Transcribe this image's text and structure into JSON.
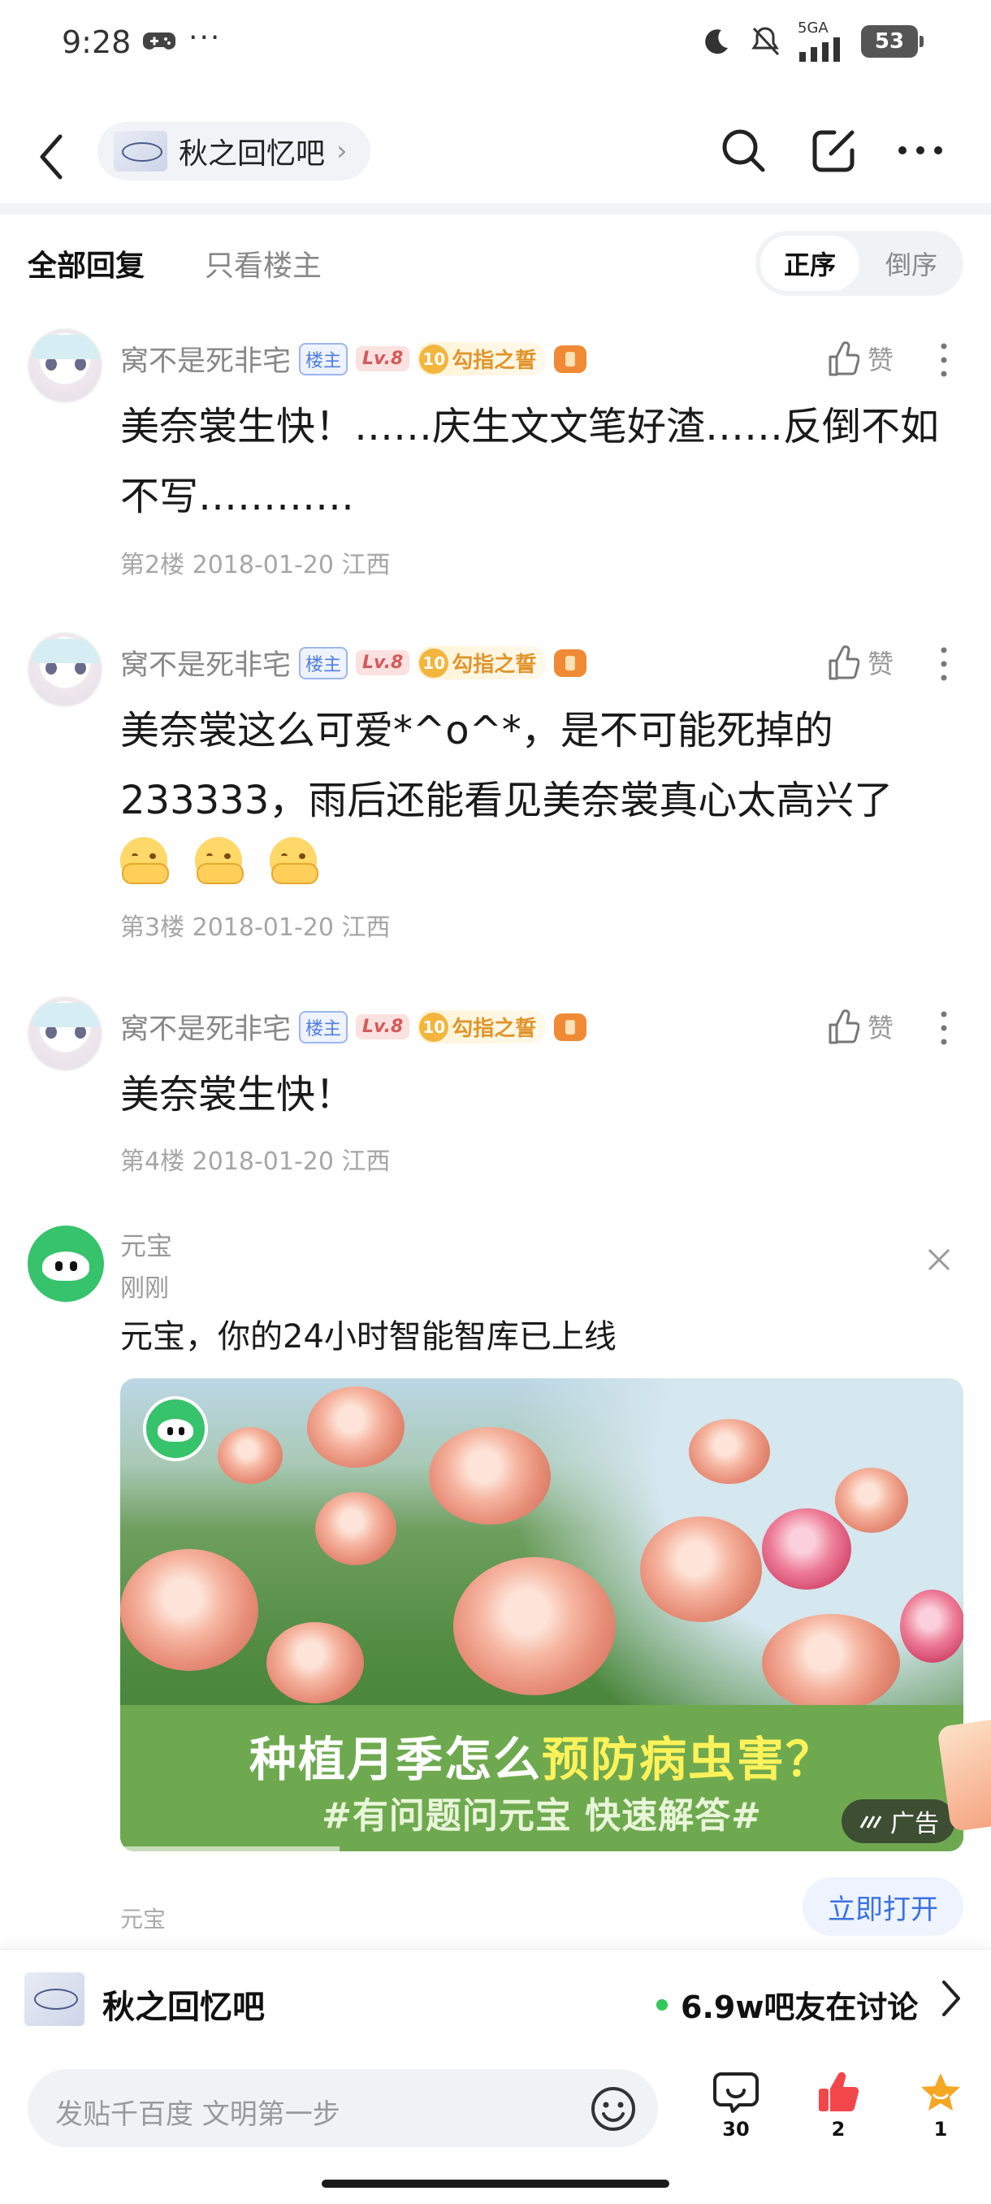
{
  "status_bar": {
    "time": "9:28",
    "dots": "···",
    "network": "5GA",
    "battery": "53"
  },
  "nav": {
    "forum_name": "秋之回忆吧"
  },
  "sort_tabs": {
    "all_replies": "全部回复",
    "owner_only": "只看楼主",
    "asc": "正序",
    "desc": "倒序"
  },
  "posts": [
    {
      "username": "窝不是死非宅",
      "owner_badge": "楼主",
      "level": "Lv.8",
      "medal_num": "10",
      "medal_text": "勾指之誓",
      "like_label": "赞",
      "content": "美奈裳生快！……庆生文文笔好渣……反倒不如不写…………",
      "meta": "第2楼 2018-01-20 江西"
    },
    {
      "username": "窝不是死非宅",
      "owner_badge": "楼主",
      "level": "Lv.8",
      "medal_num": "10",
      "medal_text": "勾指之誓",
      "like_label": "赞",
      "content": "美奈裳这么可爱*^o^*，是不可能死掉的233333，雨后还能看见美奈裳真心太高兴了",
      "emojis": [
        "hug-emoji",
        "hug-emoji",
        "hug-emoji"
      ],
      "meta": "第3楼 2018-01-20 江西"
    },
    {
      "username": "窝不是死非宅",
      "owner_badge": "楼主",
      "level": "Lv.8",
      "medal_num": "10",
      "medal_text": "勾指之誓",
      "like_label": "赞",
      "content": "美奈裳生快！",
      "meta": "第4楼 2018-01-20 江西"
    }
  ],
  "ad": {
    "name": "元宝",
    "time": "刚刚",
    "text": "元宝，你的24小时智能智库已上线",
    "headline_pre": "种植月季怎么",
    "headline_hl": "预防病虫害？",
    "subline": "#有问题问元宝 快速解答#",
    "tag": "广告",
    "advertiser": "元宝",
    "open_label": "立即打开"
  },
  "forum_strip": {
    "name": "秋之回忆吧",
    "online": "6.9w吧友在讨论"
  },
  "composer": {
    "placeholder": "发贴千百度 文明第一步",
    "comments_count": "30",
    "likes_count": "2",
    "favorites_count": "1"
  },
  "colors": {
    "accent_blue": "#3b72e3",
    "like_red": "#f2464b",
    "star_orange": "#f5a623",
    "online_green": "#34c759",
    "ad_green": "#6ea94f"
  }
}
